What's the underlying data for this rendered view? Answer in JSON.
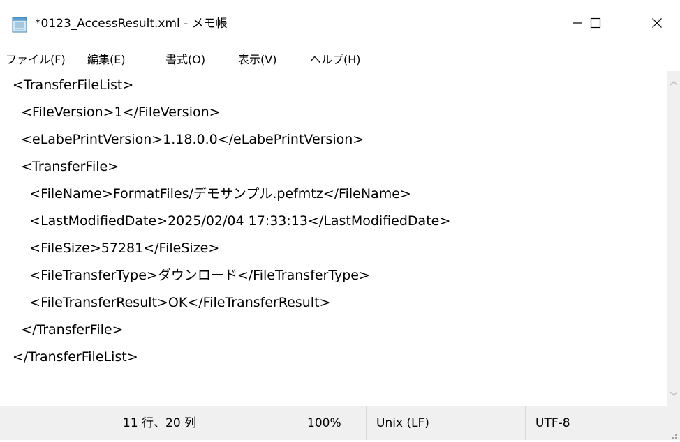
{
  "window": {
    "title": "*0123_AccessResult.xml - メモ帳",
    "minimize_glyph": "—",
    "maximize_glyph": "☐",
    "close_glyph": "✕"
  },
  "menu": {
    "items": [
      "ファイル(F)",
      "編集(E)",
      "書式(O)",
      "表示(V)",
      "ヘルプ(H)"
    ]
  },
  "editor": {
    "lines": [
      "<TransferFileList>",
      "  <FileVersion>1</FileVersion>",
      "  <eLabePrintVersion>1.18.0.0</eLabePrintVersion>",
      "  <TransferFile>",
      "    <FileName>FormatFiles/デモサンプル.pefmtz</FileName>",
      "    <LastModifiedDate>2025/02/04 17:33:13</LastModifiedDate>",
      "    <FileSize>57281</FileSize>",
      "    <FileTransferType>ダウンロード</FileTransferType>",
      "    <FileTransferResult>OK</FileTransferResult>",
      "  </TransferFile>",
      "</TransferFileList>"
    ]
  },
  "statusbar": {
    "position": "11 行、20 列",
    "zoom": "100%",
    "line_ending": "Unix (LF)",
    "encoding": "UTF-8"
  },
  "icons": {
    "app": "notepad-icon",
    "scroll_up": "chevron-up-icon",
    "scroll_down": "chevron-down-icon",
    "resize": "resize-grip-icon"
  },
  "colors": {
    "statusbar_bg": "#f0f0f0",
    "scrollbar_bg": "#f0f0f0",
    "close_hover": "#e81123"
  }
}
